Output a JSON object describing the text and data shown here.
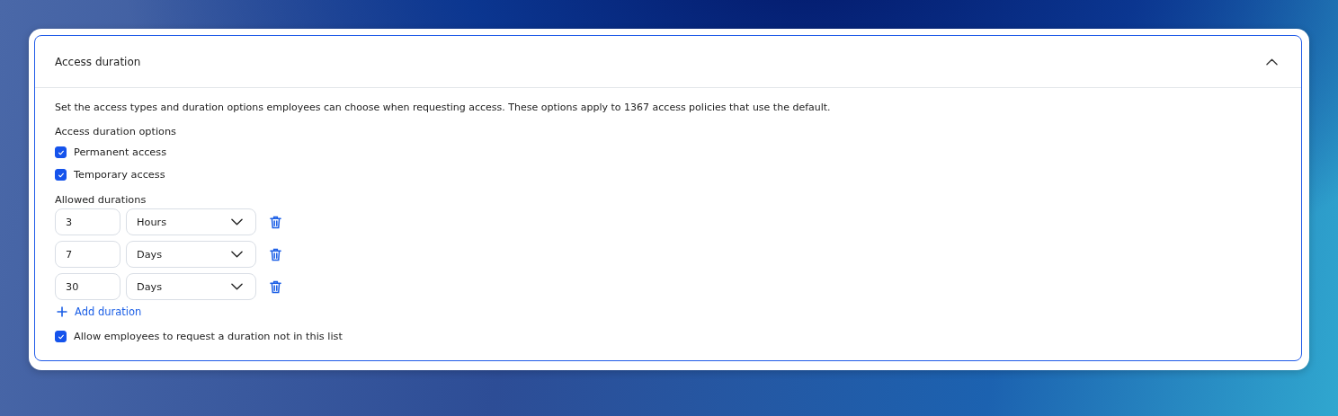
{
  "panel": {
    "title": "Access duration",
    "expanded": true
  },
  "description": "Set the access types and duration options employees can choose when requesting access. These options apply to 1367 access policies that use the default.",
  "options": {
    "label": "Access duration options",
    "items": [
      {
        "label": "Permanent access",
        "checked": true
      },
      {
        "label": "Temporary access",
        "checked": true
      }
    ]
  },
  "durations": {
    "label": "Allowed durations",
    "rows": [
      {
        "amount": "3",
        "unit": "Hours"
      },
      {
        "amount": "7",
        "unit": "Days"
      },
      {
        "amount": "30",
        "unit": "Days"
      }
    ],
    "add_label": "Add duration"
  },
  "allow_other": {
    "label": "Allow employees to request a duration not in this list",
    "checked": true
  }
}
